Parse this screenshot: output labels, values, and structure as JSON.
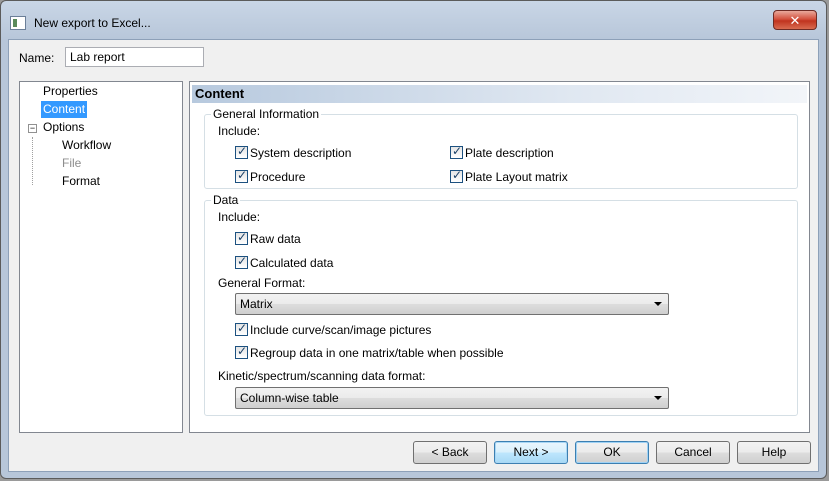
{
  "window": {
    "title": "New export to Excel..."
  },
  "name_field": {
    "label": "Name:",
    "value": "Lab report"
  },
  "tree": {
    "items": [
      {
        "label": "Properties"
      },
      {
        "label": "Content"
      },
      {
        "label": "Options"
      },
      {
        "label": "Workflow"
      },
      {
        "label": "File"
      },
      {
        "label": "Format"
      }
    ],
    "selected": "Content",
    "expander_glyph": "−"
  },
  "panel": {
    "title": "Content",
    "general_information": {
      "title": "General Information",
      "include_label": "Include:",
      "checkboxes": [
        {
          "label": "System description",
          "checked": true
        },
        {
          "label": "Plate description",
          "checked": true
        },
        {
          "label": "Procedure",
          "checked": true
        },
        {
          "label": "Plate Layout matrix",
          "checked": true
        }
      ]
    },
    "data": {
      "title": "Data",
      "include_label": "Include:",
      "raw_data": {
        "label": "Raw data",
        "checked": true
      },
      "calculated_data": {
        "label": "Calculated data",
        "checked": true
      },
      "general_format_label": "General Format:",
      "general_format_value": "Matrix",
      "include_pictures": {
        "label": "Include curve/scan/image pictures",
        "checked": true
      },
      "regroup": {
        "label": "Regroup data in one matrix/table when possible",
        "checked": true
      },
      "kinetic_label": "Kinetic/spectrum/scanning data format:",
      "kinetic_value": "Column-wise table"
    }
  },
  "buttons": {
    "back": "< Back",
    "next": "Next >",
    "ok": "OK",
    "cancel": "Cancel",
    "help": "Help"
  },
  "colors": {
    "selection": "#3399ff",
    "close_button": "#c0341f",
    "header_gradient_start": "#b7c9de"
  }
}
